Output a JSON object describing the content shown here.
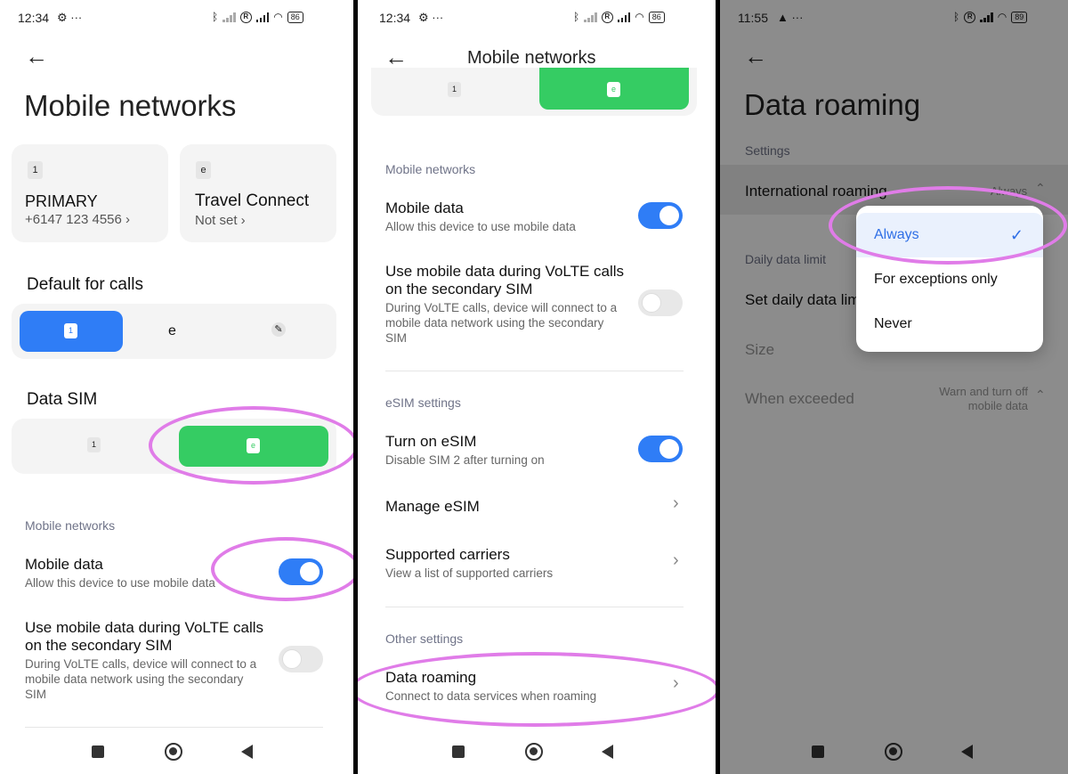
{
  "panel1": {
    "status_time": "12:34",
    "battery": "86",
    "title": "Mobile networks",
    "sim1": {
      "chip": "1",
      "name": "PRIMARY",
      "number": "+6147 123 4556 ›"
    },
    "sim2": {
      "chip": "e",
      "name": "Travel Connect",
      "status": "Not set ›"
    },
    "default_calls": {
      "heading": "Default for calls",
      "opt1": "1",
      "opt2": "e"
    },
    "data_sim": {
      "heading": "Data SIM",
      "opt1": "1",
      "opt2": "e"
    },
    "section_mobile": "Mobile networks",
    "mobile_data": {
      "title": "Mobile data",
      "sub": "Allow this device to use mobile data"
    },
    "volte": {
      "title_line1": "Use mobile data during VoLTE calls",
      "title_line2": "on the secondary SIM",
      "sub_line1": "During VoLTE calls, device will connect to a",
      "sub_line2": "mobile data network using the secondary",
      "sub_line3": "SIM"
    }
  },
  "panel2": {
    "status_time": "12:34",
    "battery": "86",
    "title": "Mobile networks",
    "tab1": "1",
    "tab2": "e",
    "section_mobile": "Mobile networks",
    "mobile_data": {
      "title": "Mobile data",
      "sub": "Allow this device to use mobile data"
    },
    "volte": {
      "title_line1": "Use mobile data during VoLTE calls",
      "title_line2": "on the secondary SIM",
      "sub_line1": "During VoLTE calls, device will connect to a",
      "sub_line2": "mobile data network using the secondary",
      "sub_line3": "SIM"
    },
    "section_esim": "eSIM settings",
    "turn_on_esim": {
      "title": "Turn on eSIM",
      "sub": "Disable SIM 2 after turning on"
    },
    "manage_esim": "Manage eSIM",
    "supported": {
      "title": "Supported carriers",
      "sub": "View a list of supported carriers"
    },
    "section_other": "Other settings",
    "data_roaming": {
      "title": "Data roaming",
      "sub": "Connect to data services when roaming"
    }
  },
  "panel3": {
    "status_time": "11:55",
    "battery": "89",
    "title": "Data roaming",
    "section_settings": "Settings",
    "intl_roaming": {
      "title": "International roaming",
      "value": "Always"
    },
    "section_daily": "Daily data limit",
    "set_daily": "Set daily data limit",
    "size": "Size",
    "when_exceeded": {
      "title": "When exceeded",
      "value_line1": "Warn and turn off",
      "value_line2": "mobile data"
    },
    "popup": {
      "opt1": "Always",
      "opt2": "For exceptions only",
      "opt3": "Never"
    }
  },
  "colors": {
    "accent_blue": "#2f7df6",
    "esim_green": "#35cc63",
    "highlight_pink": "#e07ce8"
  }
}
